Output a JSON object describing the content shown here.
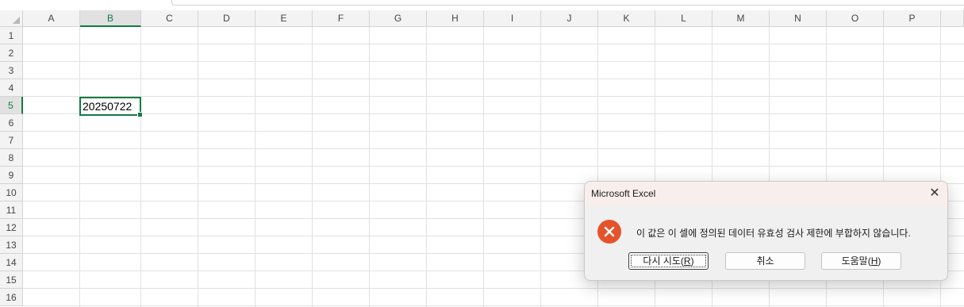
{
  "sheet": {
    "columns": [
      "A",
      "B",
      "C",
      "D",
      "E",
      "F",
      "G",
      "H",
      "I",
      "J",
      "K",
      "L",
      "M",
      "N",
      "O",
      "P"
    ],
    "rows": [
      "1",
      "2",
      "3",
      "4",
      "5",
      "6",
      "7",
      "8",
      "9",
      "10",
      "11",
      "12",
      "13",
      "14",
      "15",
      "16"
    ],
    "selected_column": "B",
    "selected_row": "5",
    "active_cell_value": "20250722",
    "header_selected_color": "#107c41"
  },
  "dialog": {
    "title": "Microsoft Excel",
    "close_glyph": "✕",
    "icon": "error-icon",
    "message": "이 값은 이 셀에 정의된 데이터 유효성 검사 제한에 부합하지 않습니다.",
    "buttons": {
      "retry": {
        "text": "다시 시도(",
        "mnemonic": "R",
        "suffix": ")"
      },
      "cancel": {
        "text": "취소"
      },
      "help": {
        "text": "도움말(",
        "mnemonic": "H",
        "suffix": ")"
      }
    },
    "error_color": "#e5532b"
  }
}
